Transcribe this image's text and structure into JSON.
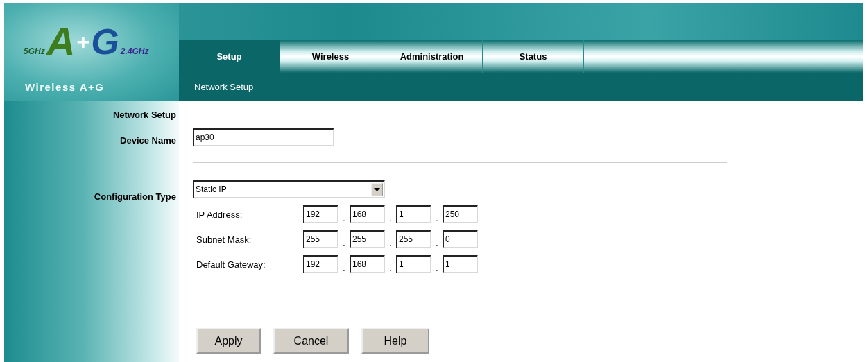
{
  "logo": {
    "letter_a": "A",
    "plus": "+",
    "letter_g": "G",
    "band_a": "5GHz",
    "band_g": "2.4GHz",
    "caption": "Wireless A+G"
  },
  "tabs": [
    {
      "label": "Setup",
      "selected": true
    },
    {
      "label": "Wireless",
      "selected": false
    },
    {
      "label": "Administration",
      "selected": false
    },
    {
      "label": "Status",
      "selected": false
    }
  ],
  "subtabs": [
    {
      "label": "Network Setup",
      "selected": true
    }
  ],
  "section_title": "Network Setup",
  "device_name": {
    "label": "Device Name",
    "value": "ap30"
  },
  "configuration_type": {
    "label": "Configuration Type",
    "value": "Static IP"
  },
  "ip_fields": [
    {
      "label": "IP Address:",
      "octets": [
        "192",
        "168",
        "1",
        "250"
      ]
    },
    {
      "label": "Subnet Mask:",
      "octets": [
        "255",
        "255",
        "255",
        "0"
      ]
    },
    {
      "label": "Default Gateway:",
      "octets": [
        "192",
        "168",
        "1",
        "1"
      ]
    }
  ],
  "separator": ".",
  "buttons": [
    "Apply",
    "Cancel",
    "Help"
  ]
}
